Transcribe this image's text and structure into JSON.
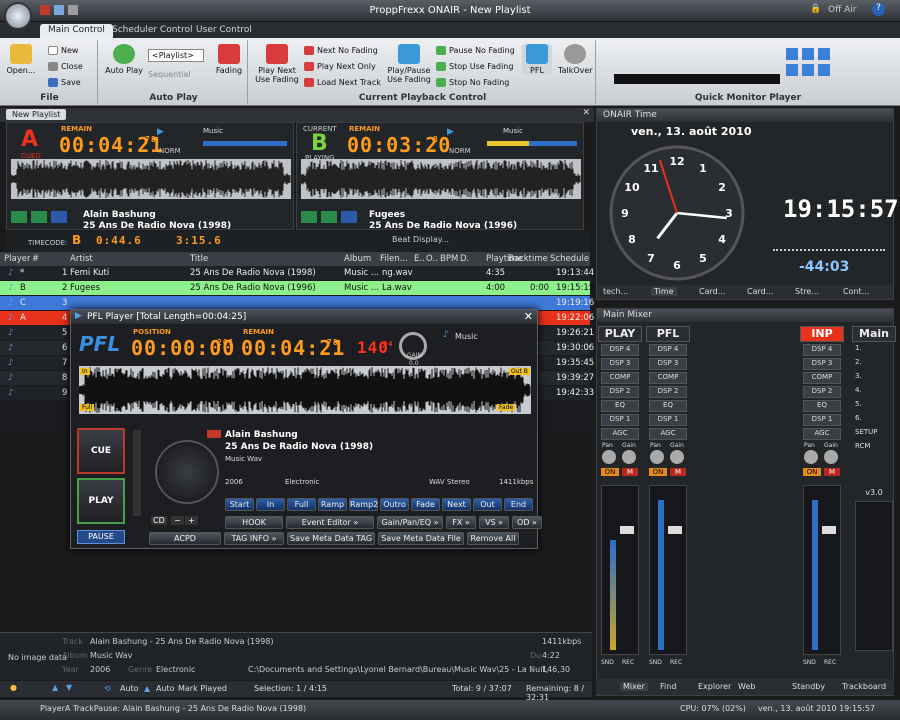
{
  "app": {
    "title": "ProppFrexx ONAIR - New Playlist",
    "off_air": "Off Air"
  },
  "tabs": [
    "Main Control",
    "Scheduler Control",
    "User Control"
  ],
  "ribbon": {
    "file": {
      "label": "File",
      "open": "Open...",
      "new": "New",
      "close": "Close",
      "save": "Save"
    },
    "autoplay": {
      "label": "Auto Play",
      "auto_play": "Auto Play",
      "playlist_select": "<Playlist>",
      "sequential": "Sequential",
      "fading": "Fading"
    },
    "playback": {
      "label": "Current Playback Control",
      "play_next_use_fading": "Play Next\nUse Fading",
      "next_no_fading": "Next No Fading",
      "play_next_only": "Play Next Only",
      "load_next_track": "Load Next Track",
      "play_pause_use_fading": "Play/Pause\nUse Fading",
      "pause_no_fading": "Pause No Fading",
      "stop_use_fading": "Stop Use Fading",
      "stop_no_fading": "Stop No Fading",
      "pfl": "PFL",
      "talkover": "TalkOver"
    },
    "monitor": {
      "label": "Quick Monitor Player"
    }
  },
  "playlist_tab": "New Playlist",
  "playerA": {
    "letter": "A",
    "state": "CUED",
    "remain_label": "REMAIN",
    "remain": "00:04:21",
    "frac": "78",
    "mode": "Music",
    "norm": "NORM",
    "title": "Alain Bashung",
    "album": "25 Ans De Radio Nova (1998)"
  },
  "playerB": {
    "letter": "B",
    "current_label": "CURRENT",
    "state": "PLAYING",
    "remain_label": "REMAIN",
    "remain": "00:03:20",
    "frac": "8",
    "mode": "Music",
    "norm": "NORM",
    "title": "Fugees",
    "album": "25 Ans De Radio Nova (1996)"
  },
  "timecode": {
    "label": "TIMECODE:",
    "b": "B",
    "pos": "0:44.6",
    "dur": "3:15.6",
    "beat": "Beat Display..."
  },
  "playlist": {
    "headers": [
      "Player",
      "#",
      "Artist",
      "Title",
      "Album",
      "Filen...",
      "E..",
      "O..",
      "BPM",
      "D.",
      "Playtime",
      "Backtime",
      "Schedule"
    ],
    "rows": [
      {
        "p": "*",
        "n": "1",
        "artist": "Femi Kuti",
        "title": "25 Ans De Radio Nova (1998)",
        "album": "Music ...",
        "file": "ng.wav",
        "play": "4:35",
        "back": "",
        "sched": "19:13:44"
      },
      {
        "p": "B",
        "n": "2",
        "artist": "Fugees",
        "title": "25 Ans De Radio Nova (1996)",
        "album": "Music ...",
        "file": "La.wav",
        "play": "4:00",
        "back": "0:00",
        "sched": "19:15:15"
      },
      {
        "p": "C",
        "n": "3",
        "artist": "",
        "title": "",
        "album": "",
        "file": "",
        "play": "",
        "back": "",
        "sched": "19:19:16"
      },
      {
        "p": "A",
        "n": "4",
        "artist": "",
        "title": "",
        "album": "",
        "file": "",
        "play": "",
        "back": "",
        "sched": "19:22:06"
      },
      {
        "p": "",
        "n": "5",
        "artist": "",
        "title": "",
        "album": "",
        "file": "",
        "play": "",
        "back": "",
        "sched": "19:26:21"
      },
      {
        "p": "",
        "n": "6",
        "artist": "",
        "title": "",
        "album": "",
        "file": "",
        "play": "",
        "back": "",
        "sched": "19:30:06"
      },
      {
        "p": "",
        "n": "7",
        "artist": "",
        "title": "",
        "album": "",
        "file": "",
        "play": "",
        "back": "",
        "sched": "19:35:45"
      },
      {
        "p": "",
        "n": "8",
        "artist": "",
        "title": "",
        "album": "",
        "file": "",
        "play": "",
        "back": "",
        "sched": "19:39:27"
      },
      {
        "p": "",
        "n": "9",
        "artist": "",
        "title": "",
        "album": "",
        "file": "",
        "play": "",
        "back": "",
        "sched": "19:42:33"
      }
    ]
  },
  "pfl": {
    "title": "PFL Player [Total Length=00:04:25]",
    "label": "PFL",
    "position_label": "POSITION",
    "position": "00:00:00",
    "position_frac": "201",
    "remain_label": "REMAIN",
    "remain": "00:04:21",
    "remain_frac": "78",
    "bpm": "140",
    "bpm_frac": "04",
    "gain_label": "GAIN",
    "gain": "0.0",
    "mode": "Music",
    "in": "In",
    "out": "Out B",
    "full": "Full",
    "fade": "Fade",
    "cue": "CUE",
    "play": "PLAY",
    "pause": "PAUSE",
    "cd": "CD",
    "artist": "Alain Bashung",
    "album": "25 Ans De Radio Nova (1998)",
    "type": "Music Wav",
    "year": "2006",
    "genre": "Electronic",
    "format": "WAV Stereo",
    "bitrate": "1411kbps",
    "buttons1": [
      "Start",
      "In",
      "Full",
      "Ramp",
      "Ramp2",
      "Outro",
      "Fade",
      "Next",
      "Out",
      "End"
    ],
    "buttons2": [
      "HOOK",
      "Event Editor »",
      "Gain/Pan/EQ »",
      "FX »",
      "VS »",
      "OD »"
    ],
    "buttons3": [
      "ACPD",
      "TAG INFO »",
      "Save Meta Data TAG",
      "Save Meta Data File",
      "Remove All"
    ]
  },
  "onair_time": {
    "title": "ONAIR Time",
    "date": "ven., 13. août 2010",
    "time": "19:15:57",
    "countdown": "-44:03",
    "clock": {
      "h": 19,
      "m": 15,
      "s": 57
    },
    "tabs": [
      "tech...",
      "Time",
      "Card...",
      "Card...",
      "Stre...",
      "Cont..."
    ]
  },
  "mixer": {
    "title": "Main Mixer",
    "channels": [
      "PLAY",
      "PFL",
      "INP",
      "Main"
    ],
    "dsp": [
      "DSP 4",
      "DSP 3",
      "COMP",
      "DSP 2",
      "EQ",
      "DSP 1",
      "AGC"
    ],
    "pan": "Pan",
    "gain": "Gain",
    "on": "ON",
    "m": "M",
    "snd": "SND",
    "rec": "REC",
    "version": "v3.0",
    "main_list": [
      "1.",
      "2.",
      "3.",
      "4.",
      "5.",
      "6.",
      "SETUP",
      "RCM"
    ],
    "tabs": [
      "Mixer",
      "Find",
      "Explorer",
      "Web",
      "Standby",
      "Trackboard"
    ]
  },
  "info": {
    "no_image": "No image data",
    "track_label": "Track",
    "track": "Alain Bashung - 25 Ans De Radio Nova (1998)",
    "album_label": "Album",
    "album": "Music Wav",
    "year_label": "Year",
    "year": "2006",
    "genre_label": "Genre",
    "genre": "Electronic",
    "path": "C:\\Documents and Settings\\Lyonel Bernard\\Bureau\\Music Wav\\25 - La Nuit, Je M",
    "bitrate": "1411kbps",
    "dur_label": "Du",
    "dur": "4:22",
    "bpm_label": "B",
    "bpm": "146,30"
  },
  "toolbar": {
    "auto1": "Auto",
    "auto2": "Auto",
    "mark": "Mark Played",
    "selection": "Selection: 1 / 4:15",
    "total": "Total: 9 / 37:07",
    "remaining": "Remaining: 8 / 32:31"
  },
  "status": {
    "left": "PlayerA TrackPause: Alain Bashung - 25 Ans De Radio Nova (1998)",
    "cpu": "CPU: 07% (02%)",
    "datetime": "ven., 13. août 2010 19:15:57"
  },
  "colors": {
    "accent": "#ff9b1a",
    "cued": "#e8321c",
    "playing": "#7bd23c",
    "rowB": "#8ef08a",
    "rowC": "#3f78d8",
    "rowA": "#e8321c"
  }
}
